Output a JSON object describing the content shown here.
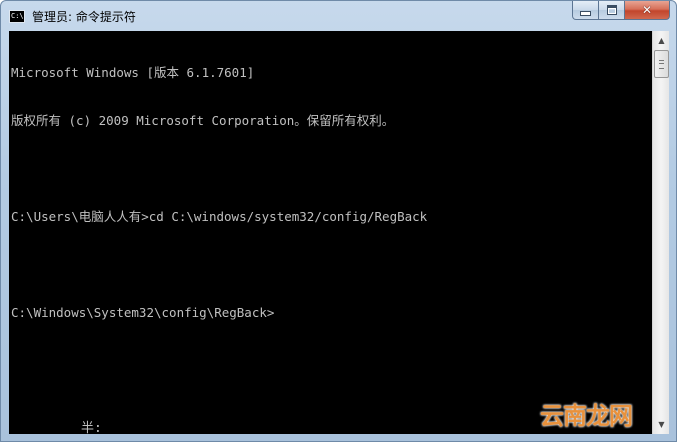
{
  "window": {
    "title": "管理员: 命令提示符",
    "app_icon": "cmd-icon",
    "app_icon_text": "C:\\",
    "caption_buttons": {
      "minimize": "minimize-icon",
      "maximize": "maximize-icon",
      "close": "close-icon",
      "close_glyph": "✕"
    }
  },
  "console": {
    "lines": [
      "Microsoft Windows [版本 6.1.7601]",
      "版权所有 (c) 2009 Microsoft Corporation。保留所有权利。",
      "",
      "C:\\Users\\电脑人人有>cd C:\\windows/system32/config/RegBack",
      "",
      "C:\\Windows\\System32\\config\\RegBack>"
    ],
    "ime_status": "半:"
  },
  "scrollbar": {
    "up_arrow": "▲",
    "down_arrow": "▼"
  },
  "watermark": {
    "text": "云南龙网"
  },
  "colors": {
    "console_bg": "#000000",
    "console_text": "#c0c0c0",
    "close_button": "#c2452c",
    "watermark": "#e8913c"
  }
}
